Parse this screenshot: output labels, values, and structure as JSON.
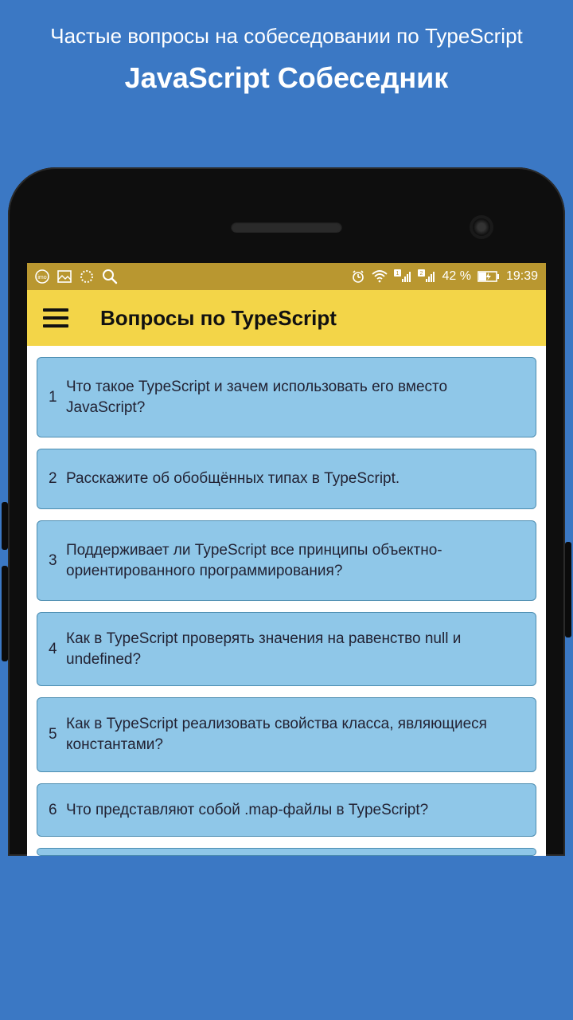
{
  "promo": {
    "title": "Частые вопросы на собеседовании по TypeScript",
    "subtitle": "JavaScript Собеседник"
  },
  "statusbar": {
    "battery_text": "42 %",
    "time": "19:39",
    "sim1": "1",
    "sim2": "2"
  },
  "appbar": {
    "title": "Вопросы по TypeScript"
  },
  "questions": [
    {
      "n": "1",
      "text": "Что такое TypeScript и зачем использовать его вместо JavaScript?"
    },
    {
      "n": "2",
      "text": "Расскажите об обобщённых типах в TypeScript."
    },
    {
      "n": "3",
      "text": "Поддерживает ли TypeScript все принципы объектно-ориентированного программирования?"
    },
    {
      "n": "4",
      "text": "Как в TypeScript проверять значения на равенство null и undefined?"
    },
    {
      "n": "5",
      "text": "Как в TypeScript реализовать свойства класса, являющиеся константами?"
    },
    {
      "n": "6",
      "text": "Что представляют собой .map-файлы в TypeScript?"
    }
  ]
}
